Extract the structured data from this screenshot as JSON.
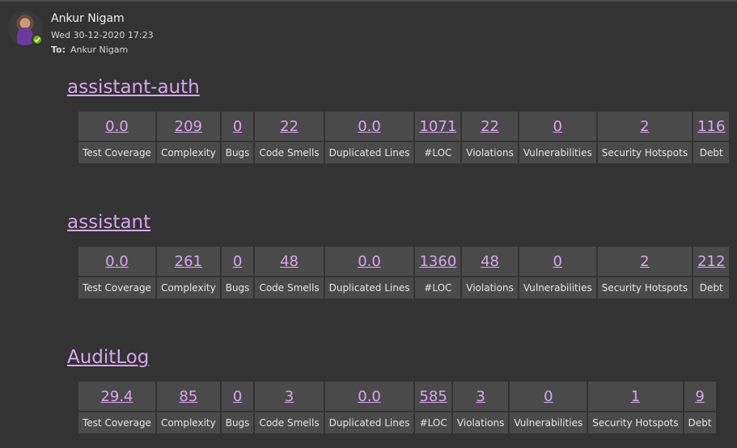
{
  "email": {
    "sender": "Ankur Nigam",
    "date": "Wed 30-12-2020 17:23",
    "to_label": "To:",
    "to": "Ankur Nigam"
  },
  "colors": {
    "background": "#333333",
    "cell": "#4a4a4a",
    "link": "#d9a6f0",
    "presence": "#6bb700"
  },
  "projects": [
    {
      "name": "assistant-auth",
      "metrics": [
        {
          "label": "Test Coverage",
          "value": "0.0"
        },
        {
          "label": "Complexity",
          "value": "209"
        },
        {
          "label": "Bugs",
          "value": "0"
        },
        {
          "label": "Code Smells",
          "value": "22"
        },
        {
          "label": "Duplicated Lines",
          "value": "0.0"
        },
        {
          "label": "#LOC",
          "value": "1071"
        },
        {
          "label": "Violations",
          "value": "22"
        },
        {
          "label": "Vulnerabilities",
          "value": "0"
        },
        {
          "label": "Security Hotspots",
          "value": "2"
        },
        {
          "label": "Debt",
          "value": "116"
        }
      ]
    },
    {
      "name": "assistant",
      "metrics": [
        {
          "label": "Test Coverage",
          "value": "0.0"
        },
        {
          "label": "Complexity",
          "value": "261"
        },
        {
          "label": "Bugs",
          "value": "0"
        },
        {
          "label": "Code Smells",
          "value": "48"
        },
        {
          "label": "Duplicated Lines",
          "value": "0.0"
        },
        {
          "label": "#LOC",
          "value": "1360"
        },
        {
          "label": "Violations",
          "value": "48"
        },
        {
          "label": "Vulnerabilities",
          "value": "0"
        },
        {
          "label": "Security Hotspots",
          "value": "2"
        },
        {
          "label": "Debt",
          "value": "212"
        }
      ]
    },
    {
      "name": "AuditLog",
      "metrics": [
        {
          "label": "Test Coverage",
          "value": "29.4"
        },
        {
          "label": "Complexity",
          "value": "85"
        },
        {
          "label": "Bugs",
          "value": "0"
        },
        {
          "label": "Code Smells",
          "value": "3"
        },
        {
          "label": "Duplicated Lines",
          "value": "0.0"
        },
        {
          "label": "#LOC",
          "value": "585"
        },
        {
          "label": "Violations",
          "value": "3"
        },
        {
          "label": "Vulnerabilities",
          "value": "0"
        },
        {
          "label": "Security Hotspots",
          "value": "1"
        },
        {
          "label": "Debt",
          "value": "9"
        }
      ]
    }
  ]
}
